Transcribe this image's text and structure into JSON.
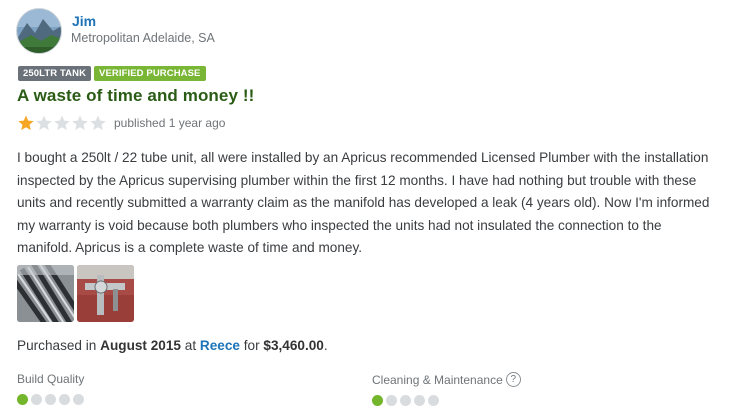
{
  "reviewer": {
    "name": "Jim",
    "location": "Metropolitan Adelaide, SA"
  },
  "tags": [
    {
      "label": "250LTR TANK",
      "color": "#6b7178"
    },
    {
      "label": "VERIFIED PURCHASE",
      "color": "#7ab636"
    }
  ],
  "review": {
    "title": "A waste of time and money !!",
    "rating": 1,
    "rating_max": 5,
    "published": "published 1 year ago",
    "body": "I bought a 250lt / 22 tube unit, all were installed by an Apricus recommended Licensed Plumber with the installation inspected by the Apricus supervising plumber within the first 12 months. I have had nothing but trouble with these units and recently submitted a warranty claim as the manifold has developed a leak (4 years old). Now I'm informed my warranty is void because both plumbers who inspected the units had not insulated the connection to the manifold. Apricus is a complete waste of time and money."
  },
  "photos": [
    {
      "subject": "solar-tubes-photo"
    },
    {
      "subject": "manifold-leak-photo"
    }
  ],
  "purchase": {
    "prefix": "Purchased in",
    "date": "August 2015",
    "at": "at",
    "store": "Reece",
    "for": "for",
    "price": "$3,460.00",
    "suffix": "."
  },
  "ratings": [
    {
      "label": "Build Quality",
      "score": 1,
      "max": 5,
      "help": false
    },
    {
      "label": "Cleaning & Maintenance",
      "score": 1,
      "max": 5,
      "help": true,
      "help_glyph": "?"
    }
  ],
  "colors": {
    "star_on": "#f5a623",
    "star_off": "#dde0e3",
    "dot_on": "#73b52b",
    "dot_off": "#d9dcdf",
    "link": "#1f74b8",
    "title": "#2a5c15"
  }
}
